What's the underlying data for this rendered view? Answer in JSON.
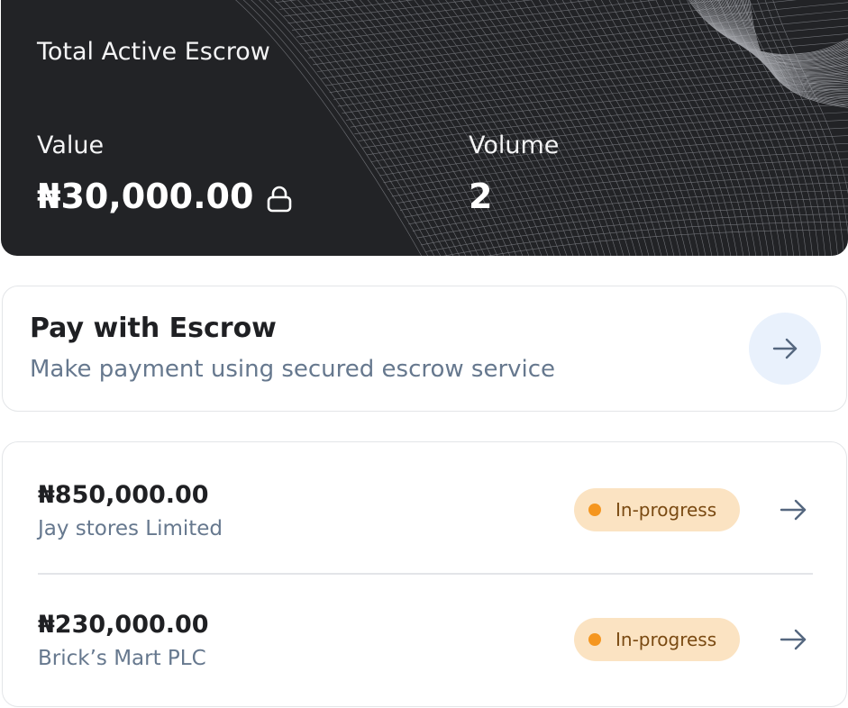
{
  "summary": {
    "title": "Total Active Escrow",
    "value_label": "Value",
    "value_amount": "₦30,000.00",
    "volume_label": "Volume",
    "volume_count": "2",
    "lock_icon": "lock-icon"
  },
  "pay_card": {
    "title": "Pay with Escrow",
    "subtitle": "Make payment using secured escrow service",
    "arrow_icon": "arrow-right-icon"
  },
  "escrows": [
    {
      "amount": "₦850,000.00",
      "merchant": "Jay stores Limited",
      "status": "In-progress"
    },
    {
      "amount": "₦230,000.00",
      "merchant": "Brick’s Mart PLC",
      "status": "In-progress"
    }
  ],
  "colors": {
    "summary_bg": "#222326",
    "status_bg": "#fbe3c2",
    "status_dot": "#f5961f",
    "subtitle_text": "#66788e",
    "arrow_button_bg": "#e9f1fc"
  }
}
